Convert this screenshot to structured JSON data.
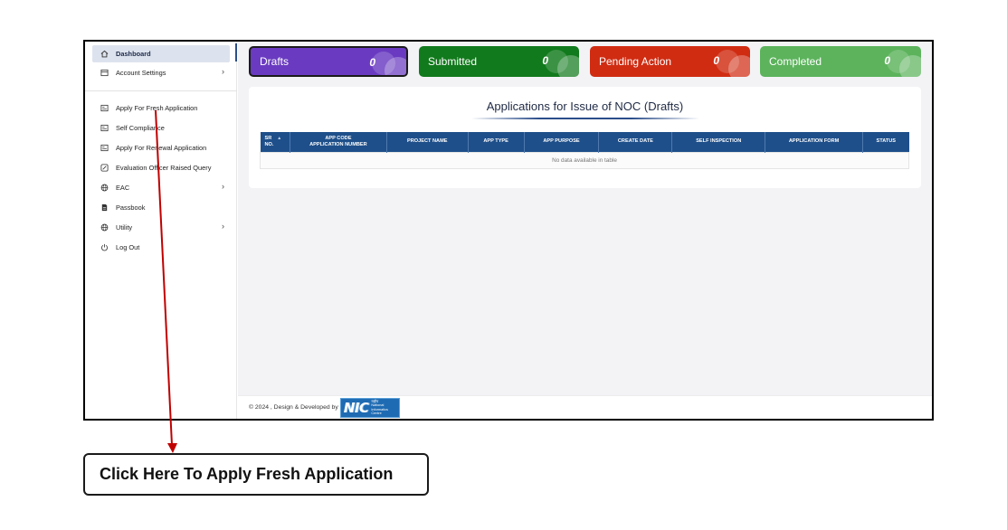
{
  "sidebar": {
    "items": [
      {
        "label": "Dashboard",
        "icon": "home-icon",
        "active": true
      },
      {
        "label": "Account Settings",
        "icon": "id-card-icon",
        "chevron": true
      },
      {
        "label": "Apply For Fresh Application",
        "icon": "form-icon"
      },
      {
        "label": "Self Compliance",
        "icon": "form-icon"
      },
      {
        "label": "Apply For Renewal Application",
        "icon": "form-icon"
      },
      {
        "label": "Evaluation Officer Raised Query",
        "icon": "edit-icon"
      },
      {
        "label": "EAC",
        "icon": "globe-icon",
        "chevron": true
      },
      {
        "label": "Passbook",
        "icon": "document-icon"
      },
      {
        "label": "Utility",
        "icon": "globe-icon",
        "chevron": true
      },
      {
        "label": "Log Out",
        "icon": "power-icon"
      }
    ]
  },
  "cards": {
    "drafts": {
      "label": "Drafts",
      "count": "0",
      "color": "#6a3bc1"
    },
    "submitted": {
      "label": "Submitted",
      "count": "0",
      "color": "#117a1c"
    },
    "pending": {
      "label": "Pending Action",
      "count": "0",
      "color": "#d02c12"
    },
    "completed": {
      "label": "Completed",
      "count": "0",
      "color": "#5cb35c"
    }
  },
  "panel": {
    "title": "Applications for Issue of NOC (Drafts)"
  },
  "table": {
    "headers": {
      "sr_line1": "SR",
      "sr_line2": "NO.",
      "app_code_line1": "APP CODE",
      "app_code_line2": "APPLICATION NUMBER",
      "project_name": "PROJECT NAME",
      "app_type": "APP TYPE",
      "app_purpose": "APP PURPOSE",
      "create_date": "CREATE DATE",
      "self_inspection": "SELF INSPECTION",
      "application_form": "APPLICATION FORM",
      "status": "STATUS"
    },
    "empty_message": "No data available in table",
    "header_color": "#1e4f8a"
  },
  "footer": {
    "text": "© 2024 , Design & Developed by",
    "logo_text": "NIC",
    "logo_small_line1": "राष्ट्रीय",
    "logo_small_line2": "National",
    "logo_small_line3": "Informatics",
    "logo_small_line4": "Centre"
  },
  "annotation": {
    "callout_text": "Click Here To Apply Fresh Application",
    "arrow_color": "#c00000"
  }
}
